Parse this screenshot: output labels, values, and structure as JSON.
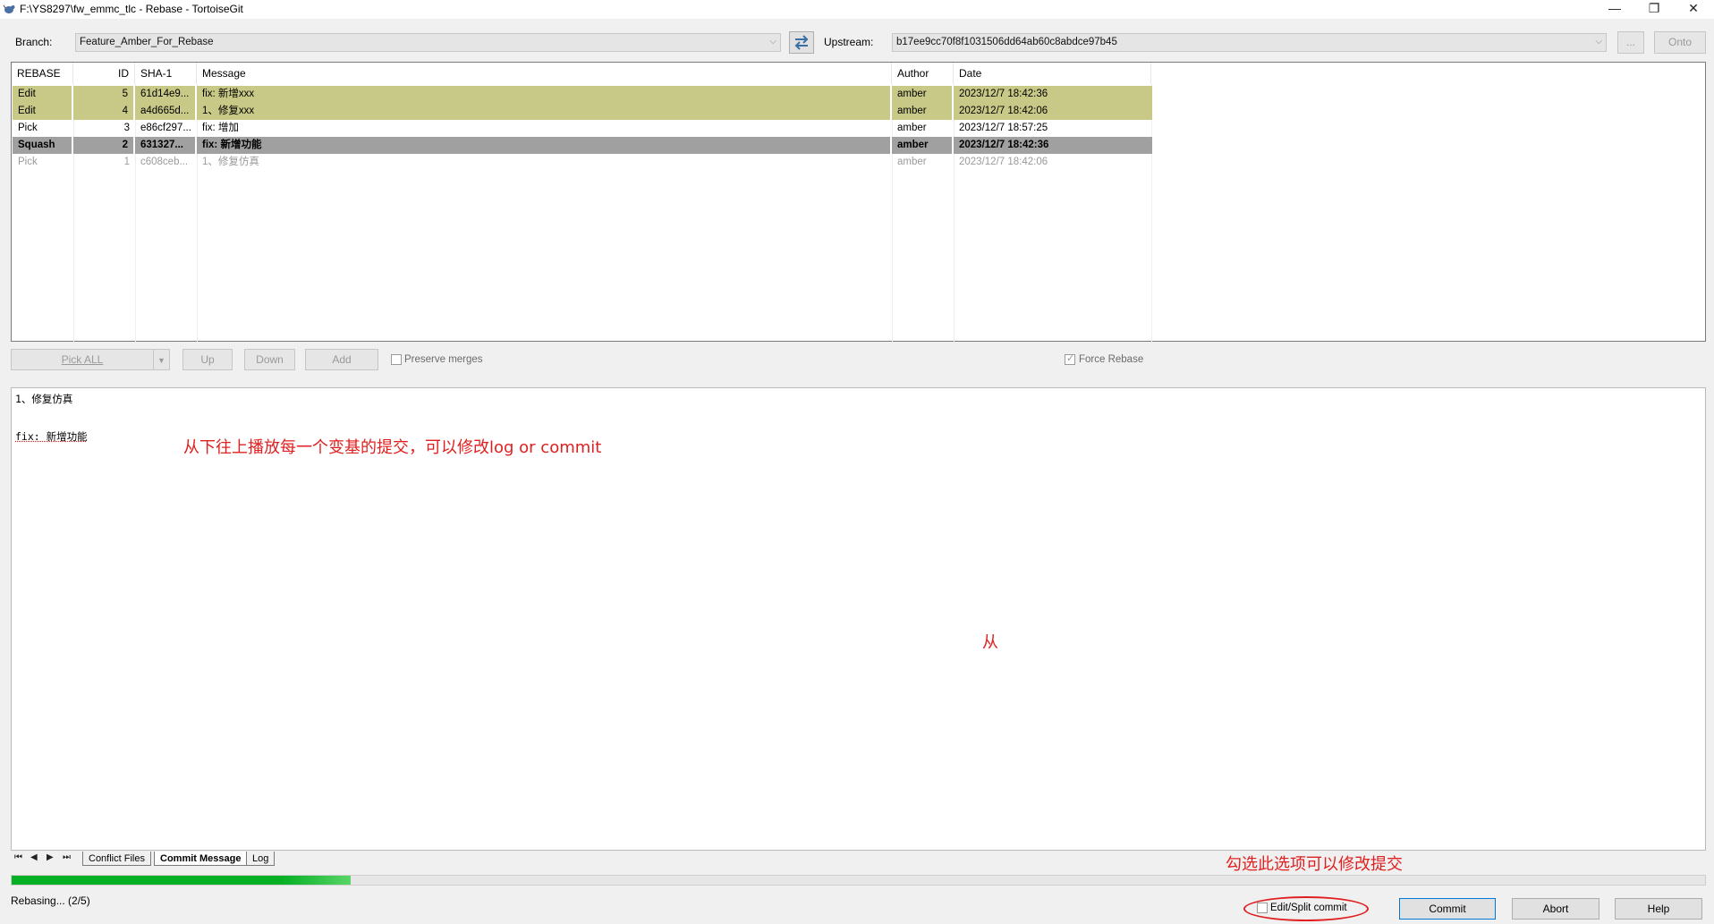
{
  "window": {
    "title": "F:\\YS8297\\fw_emmc_tlc - Rebase - TortoiseGit",
    "controls": {
      "minimize": "—",
      "restore": "❐",
      "close": "✕"
    }
  },
  "branch": {
    "label": "Branch:",
    "value": "Feature_Amber_For_Rebase",
    "upstream_label": "Upstream:",
    "upstream_value": "b17ee9cc70f8f1031506dd64ab60c8abdce97b45",
    "browse_label": "...",
    "onto_label": "Onto"
  },
  "list": {
    "columns": [
      "REBASE",
      "ID",
      "SHA-1",
      "Message",
      "Author",
      "Date"
    ],
    "rows": [
      {
        "action": "Edit",
        "id": "5",
        "sha": "61d14e9...",
        "message": "fix: 新增xxx",
        "author": "amber",
        "date": "2023/12/7 18:42:36",
        "style": "edit"
      },
      {
        "action": "Edit",
        "id": "4",
        "sha": "a4d665d...",
        "message": "1、修复xxx",
        "author": "amber",
        "date": "2023/12/7 18:42:06",
        "style": "edit"
      },
      {
        "action": "Pick",
        "id": "3",
        "sha": "e86cf297...",
        "message": "fix: 增加",
        "author": "amber",
        "date": "2023/12/7 18:57:25",
        "style": "normal"
      },
      {
        "action": "Squash",
        "id": "2",
        "sha": "631327...",
        "message": "fix: 新增功能",
        "author": "amber",
        "date": "2023/12/7 18:42:36",
        "style": "squash"
      },
      {
        "action": "Pick",
        "id": "1",
        "sha": "c608ceb...",
        "message": "1、修复仿真",
        "author": "amber",
        "date": "2023/12/7 18:42:06",
        "style": "dim"
      }
    ]
  },
  "controls": {
    "pick_all": "Pick ALL",
    "up": "Up",
    "down": "Down",
    "add": "Add",
    "preserve_merges": "Preserve merges",
    "force_rebase": "Force Rebase"
  },
  "message": {
    "lines": [
      "1、修复仿真",
      "",
      "fix: 新增功能"
    ],
    "annotation_main": "从下往上播放每一个变基的提交，可以修改log or commit",
    "annotation_mid": "从",
    "annotation_bottom": "勾选此选项可以修改提交"
  },
  "tabs": {
    "nav": [
      "⏮",
      "◀",
      "▶",
      "⏭"
    ],
    "items": [
      "Conflict Files",
      "Commit Message",
      "Log"
    ],
    "active": "Commit Message"
  },
  "progress": {
    "fraction": 0.2
  },
  "status": {
    "text": "Rebasing... (2/5)",
    "edit_split_label": "Edit/Split commit",
    "commit_label": "Commit",
    "abort_label": "Abort",
    "help_label": "Help"
  },
  "colors": {
    "edit_row": "#c8c987",
    "squash_row": "#a0a0a0",
    "annotation": "#e02020",
    "progress": "#06b025",
    "commit_border": "#0078d7"
  }
}
